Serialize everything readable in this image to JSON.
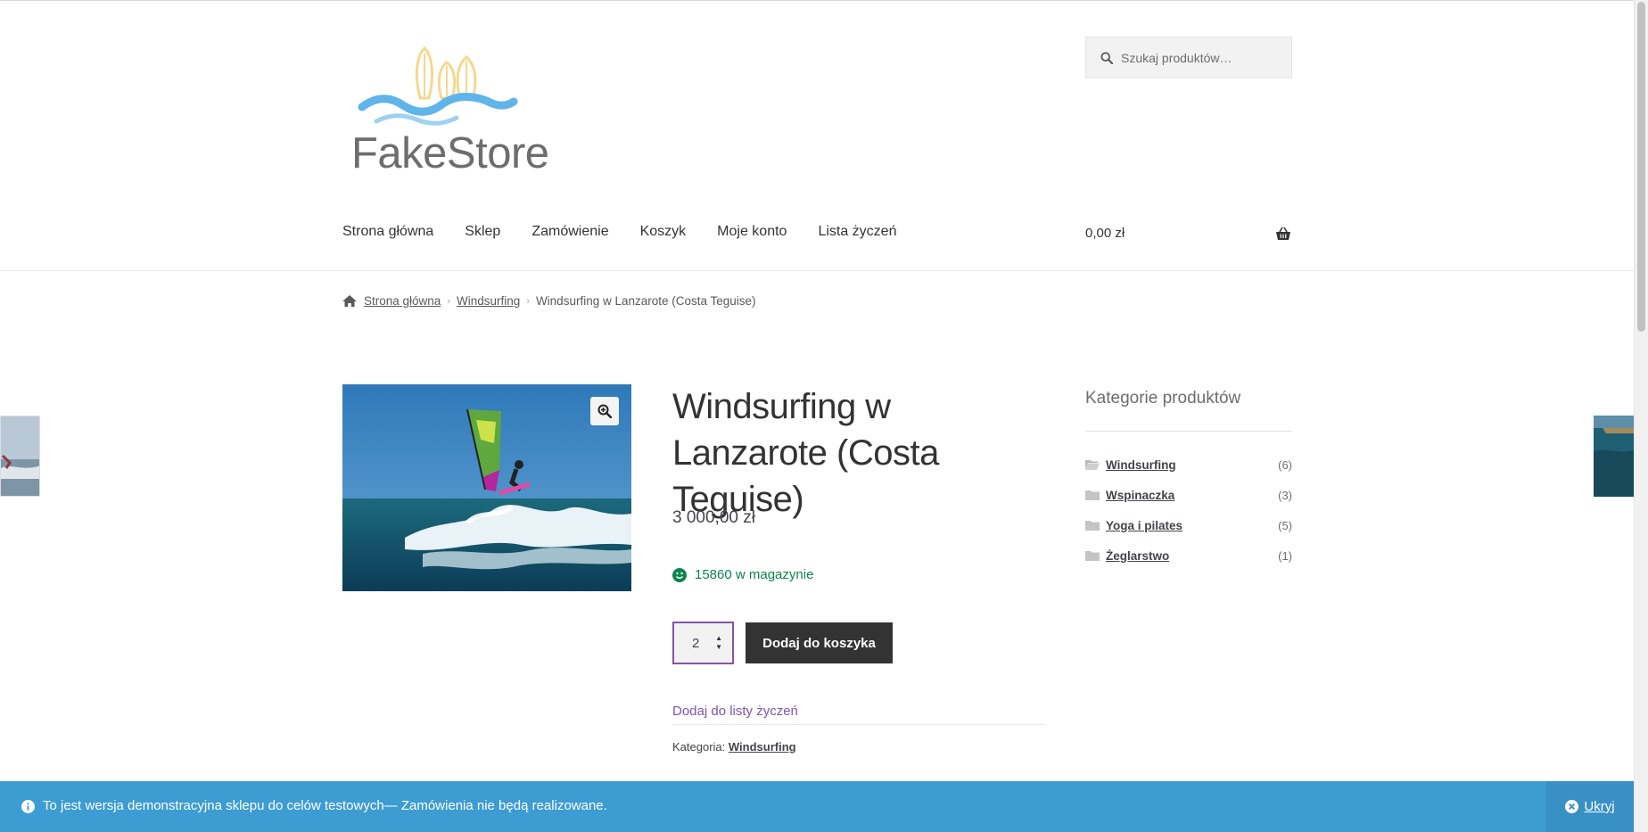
{
  "brand": {
    "logo_text": "FakeStore"
  },
  "search": {
    "placeholder": "Szukaj produktów…"
  },
  "nav": {
    "items": [
      "Strona główna",
      "Sklep",
      "Zamówienie",
      "Koszyk",
      "Moje konto",
      "Lista życzeń"
    ],
    "cart_total": "0,00 zł"
  },
  "breadcrumb": {
    "home": "Strona główna",
    "category": "Windsurfing",
    "current": "Windsurfing w Lanzarote (Costa Teguise)"
  },
  "product": {
    "title": "Windsurfing w Lanzarote (Costa Teguise)",
    "price": "3 000,00 zł",
    "stock": "15860 w magazynie",
    "quantity": "2",
    "add_to_cart": "Dodaj do koszyka",
    "wishlist": "Dodaj do listy życzeń",
    "category_label": "Kategoria:",
    "category": "Windsurfing"
  },
  "sidebar": {
    "title": "Kategorie produktów",
    "categories": [
      {
        "name": "Windsurfing",
        "count": "(6)"
      },
      {
        "name": "Wspinaczka",
        "count": "(3)"
      },
      {
        "name": "Yoga i pilates",
        "count": "(5)"
      },
      {
        "name": "Żeglarstwo",
        "count": "(1)"
      }
    ]
  },
  "notice": {
    "text": "To jest wersja demonstracyjna sklepu do celów testowych— Zamówienia nie będą realizowane.",
    "dismiss": "Ukryj"
  },
  "icons": {
    "search": "search-icon",
    "cart": "basket-icon",
    "home": "home-icon",
    "zoom": "zoom-in-icon",
    "stock": "smile-icon",
    "folder": "folder-icon",
    "info": "info-icon",
    "close": "close-circle-icon"
  },
  "colors": {
    "accent": "#7f54b3",
    "stock_green": "#0f834d",
    "button_dark": "#333333",
    "notice_blue": "#3d9cd2"
  }
}
